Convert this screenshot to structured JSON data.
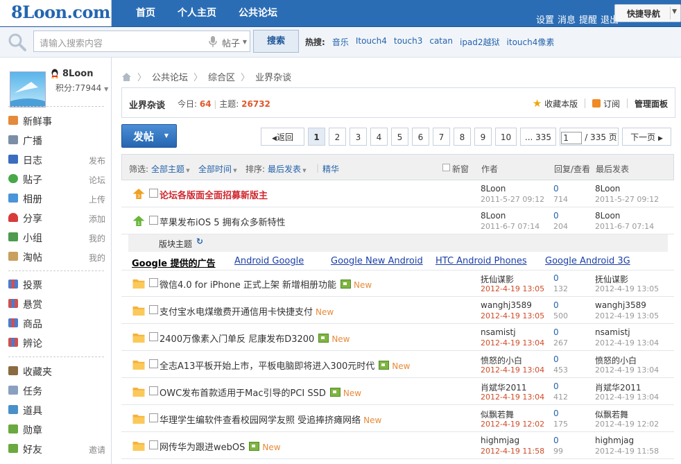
{
  "site": {
    "logo": "8Loon.com"
  },
  "topnav": [
    "首页",
    "个人主页",
    "公共论坛"
  ],
  "toplinks": [
    "设置",
    "消息",
    "提醒",
    "退出"
  ],
  "quicknav": {
    "label": "快捷导航"
  },
  "search": {
    "placeholder": "请输入搜索内容",
    "category": "帖子",
    "button": "搜索",
    "hot_label": "热搜:",
    "hot": [
      "音乐",
      "Itouch4",
      "touch3",
      "catan",
      "ipad2越狱",
      "itouch4像素"
    ]
  },
  "user": {
    "name": "8Loon",
    "score_label": "积分:",
    "score": "77944"
  },
  "menu1": [
    {
      "label": "新鲜事",
      "extra": "",
      "color": "#e48a3a"
    },
    {
      "label": "广播",
      "extra": "",
      "color": "#7a8ea6"
    },
    {
      "label": "日志",
      "extra": "发布",
      "color": "#3b6cc0"
    },
    {
      "label": "贴子",
      "extra": "论坛",
      "color": "#48a848"
    },
    {
      "label": "相册",
      "extra": "上传",
      "color": "#4a94d8"
    },
    {
      "label": "分享",
      "extra": "添加",
      "color": "#d83a3a"
    },
    {
      "label": "小组",
      "extra": "我的",
      "color": "#4e9a4e"
    },
    {
      "label": "淘帖",
      "extra": "我的",
      "color": "#c8a060"
    }
  ],
  "menu2": [
    {
      "label": "投票",
      "color": "#4a7cd0"
    },
    {
      "label": "悬赏",
      "color": "#d05050"
    },
    {
      "label": "商品",
      "color": "#4a7cd0"
    },
    {
      "label": "辨论",
      "color": "#d05050"
    }
  ],
  "menu3": [
    {
      "label": "收藏夹",
      "extra": "",
      "color": "#8a6a40"
    },
    {
      "label": "任务",
      "extra": "",
      "color": "#8aa0c0"
    },
    {
      "label": "道具",
      "extra": "",
      "color": "#4a90c8"
    },
    {
      "label": "勋章",
      "extra": "",
      "color": "#6aa840"
    },
    {
      "label": "好友",
      "extra": "邀请",
      "color": "#6aa840"
    }
  ],
  "breadcrumb": [
    "公共论坛",
    "综合区",
    "业界杂谈"
  ],
  "forum": {
    "name": "业界杂谈",
    "today_label": "今日:",
    "today": "64",
    "threads_label": "主题:",
    "threads": "26732",
    "fav": "收藏本版",
    "subscribe": "订阅",
    "manage": "管理面板"
  },
  "post_button": "发帖",
  "pager": {
    "prev": "返回",
    "pages": [
      "1",
      "2",
      "3",
      "4",
      "5",
      "6",
      "7",
      "8",
      "9",
      "10"
    ],
    "last": "... 335",
    "current_input": "1",
    "total": "/ 335 页",
    "next": "下一页"
  },
  "filters": {
    "label": "筛选:",
    "all_threads": "全部主题",
    "all_time": "全部时间",
    "sort_label": "排序:",
    "sort": "最后发表",
    "digest": "精华",
    "new_window": "新窗",
    "author": "作者",
    "replies": "回复/查看",
    "last_post": "最后发表"
  },
  "pinned": [
    {
      "title": "论坛各版面全面招募新版主",
      "author": "8Loon",
      "date": "2011-5-27 09:12",
      "replies": "0",
      "views": "714",
      "last_user": "8Loon",
      "last_date": "2011-5-27 09:12"
    },
    {
      "title": "苹果发布iOS 5 拥有众多新特性",
      "author": "8Loon",
      "date": "2011-6-7 07:14",
      "replies": "0",
      "views": "204",
      "last_user": "8Loon",
      "last_date": "2011-6-7 07:14"
    }
  ],
  "section_label": "版块主题",
  "ads": {
    "label": "Google 提供的广告",
    "links": [
      "Android Google",
      "Google New Android",
      "HTC Android Phones",
      "Google Android 3G"
    ]
  },
  "threads": [
    {
      "title": "微信4.0 for iPhone 正式上架 新增相册功能",
      "attach": true,
      "new": "New",
      "author": "抚仙谋影",
      "date": "2012-4-19 13:05",
      "replies": "0",
      "views": "132",
      "last_user": "抚仙谋影",
      "last_date": "2012-4-19 13:05"
    },
    {
      "title": "支付宝水电煤缴费开通信用卡快捷支付",
      "attach": false,
      "new": "New",
      "author": "wanghj3589",
      "date": "2012-4-19 13:05",
      "replies": "0",
      "views": "500",
      "last_user": "wanghj3589",
      "last_date": "2012-4-19 13:05"
    },
    {
      "title": "2400万像素入门单反 尼康发布D3200",
      "attach": true,
      "new": "New",
      "author": "nsamistj",
      "date": "2012-4-19 13:04",
      "replies": "0",
      "views": "267",
      "last_user": "nsamistj",
      "last_date": "2012-4-19 13:04"
    },
    {
      "title": "全志A13平板开始上市，平板电脑即将进入300元时代",
      "attach": true,
      "new": "New",
      "author": "愤怒的小白",
      "date": "2012-4-19 13:04",
      "replies": "0",
      "views": "453",
      "last_user": "愤怒的小白",
      "last_date": "2012-4-19 13:04"
    },
    {
      "title": "OWC发布首款适用于Mac引导的PCI SSD",
      "attach": true,
      "new": "New",
      "author": "肖斌华2011",
      "date": "2012-4-19 13:04",
      "replies": "0",
      "views": "412",
      "last_user": "肖斌华2011",
      "last_date": "2012-4-19 13:04"
    },
    {
      "title": "华理学生编软件查看校园网学友照 受追捧挤瘫网络",
      "attach": false,
      "new": "New",
      "author": "似飘若舞",
      "date": "2012-4-19 12:02",
      "replies": "0",
      "views": "175",
      "last_user": "似飘若舞",
      "last_date": "2012-4-19 12:02"
    },
    {
      "title": "网传华为跟进webOS",
      "attach": true,
      "new": "New",
      "author": "highmjag",
      "date": "2012-4-19 11:58",
      "replies": "0",
      "views": "99",
      "last_user": "highmjag",
      "last_date": "2012-4-19 11:58"
    }
  ]
}
